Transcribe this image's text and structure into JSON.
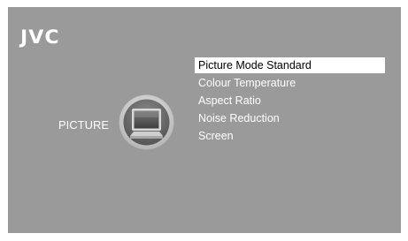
{
  "brand": {
    "logo_text": "JVC"
  },
  "category": {
    "label": "PICTURE",
    "icon": "tv-icon"
  },
  "menu": {
    "selected_index": 0,
    "items": [
      {
        "label": "Picture Mode Standard"
      },
      {
        "label": "Colour Temperature"
      },
      {
        "label": "Aspect Ratio"
      },
      {
        "label": "Noise Reduction"
      },
      {
        "label": "Screen"
      }
    ]
  },
  "colors": {
    "background": "#9a9a9a",
    "text": "#ffffff",
    "highlight": "#ffffff",
    "highlight_text": "#000000"
  }
}
